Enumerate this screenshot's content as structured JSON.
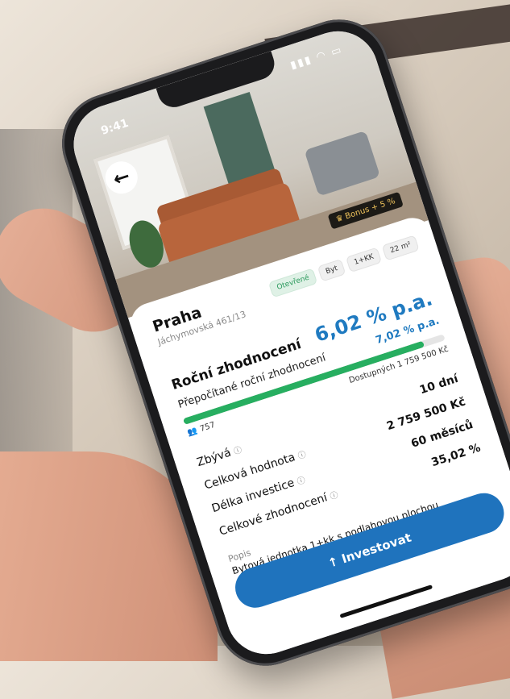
{
  "status": {
    "time": "9:41",
    "icons": "▮▮▮ ◠ ▭"
  },
  "header": {
    "back_icon": "arrow-left-icon",
    "bonus_label": "♛ Bonus + 5 %"
  },
  "property": {
    "city": "Praha",
    "address": "Jáchymovská 461/13",
    "tags": [
      "Otevřené",
      "Byt",
      "1+KK",
      "22 m²"
    ]
  },
  "yield": {
    "label": "Roční zhodnocení",
    "value": "6,02 % p.a.",
    "recalc_label": "Přepočítané roční zhodnocení",
    "recalc_value": "7,02 % p.a."
  },
  "funding": {
    "progress_percent": 92,
    "investors": "757",
    "available": "Dostupných 1 759 500 Kč"
  },
  "stats": [
    {
      "label": "Zbývá",
      "value": "10 dní"
    },
    {
      "label": "Celková hodnota",
      "value": "2 759 500 Kč"
    },
    {
      "label": "Délka investice",
      "value": "60 měsíců"
    },
    {
      "label": "Celkové zhodnocení",
      "value": "35,02 %"
    }
  ],
  "description": {
    "label": "Popis",
    "text": "Bytová jednotka 1+kk s podlahovou plochou"
  },
  "cta": {
    "label": "↑ Investovat"
  },
  "colors": {
    "accent": "#1f73bd",
    "progress": "#27ae60",
    "open_tag": "#2c9a5d"
  }
}
